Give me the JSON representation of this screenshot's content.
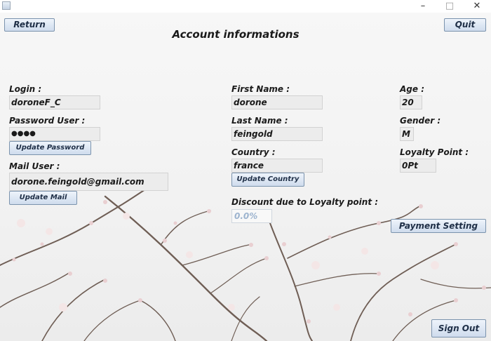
{
  "window": {
    "minimize_glyph": "–",
    "maximize_glyph": "□",
    "close_glyph": "✕"
  },
  "header": {
    "return_label": "Return",
    "quit_label": "Quit",
    "title": "Account informations"
  },
  "left": {
    "login_label": "Login :",
    "login_value": "doroneF_C",
    "password_label": "Password User :",
    "password_value": "●●●●",
    "update_password_label": "Update Password",
    "mail_label": "Mail User :",
    "mail_value": "dorone.feingold@gmail.com",
    "update_mail_label": "Update Mail"
  },
  "middle": {
    "first_name_label": "First Name :",
    "first_name_value": "dorone",
    "last_name_label": "Last Name :",
    "last_name_value": "feingold",
    "country_label": "Country :",
    "country_value": "france",
    "update_country_label": "Update Country",
    "discount_label": "Discount due to Loyalty point :",
    "discount_value": "0.0%"
  },
  "right": {
    "age_label": "Age :",
    "age_value": "20",
    "gender_label": "Gender :",
    "gender_value": "M",
    "loyalty_label": "Loyalty Point :",
    "loyalty_value": "0Pt",
    "payment_setting_label": "Payment Setting"
  },
  "footer": {
    "sign_out_label": "Sign Out"
  }
}
